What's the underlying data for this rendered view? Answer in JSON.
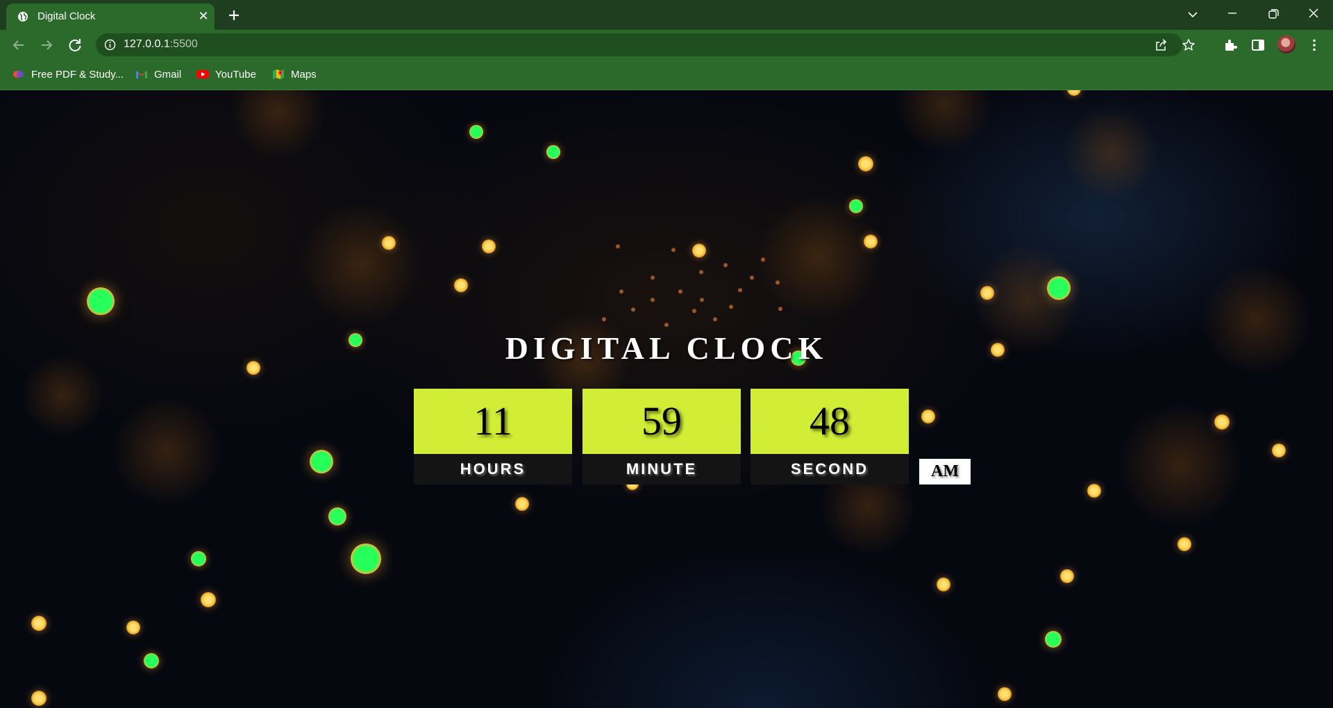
{
  "browser": {
    "tab_title": "Digital Clock",
    "url_host": "127.0.0.1",
    "url_port": ":5500",
    "bookmarks": [
      {
        "label": "Free PDF & Study...",
        "icon": "study-app-icon"
      },
      {
        "label": "Gmail",
        "icon": "gmail-icon"
      },
      {
        "label": "YouTube",
        "icon": "youtube-icon"
      },
      {
        "label": "Maps",
        "icon": "maps-icon"
      }
    ],
    "theme_color": "#2b6a2b"
  },
  "clock": {
    "title": "DIGITAL CLOCK",
    "hours": "11",
    "minutes": "59",
    "seconds": "48",
    "hours_label": "HOURS",
    "minutes_label": "MINUTE",
    "seconds_label": "SECOND",
    "period": "AM",
    "digit_bg_color": "#d2ed35",
    "label_bg_color": "#141414"
  }
}
